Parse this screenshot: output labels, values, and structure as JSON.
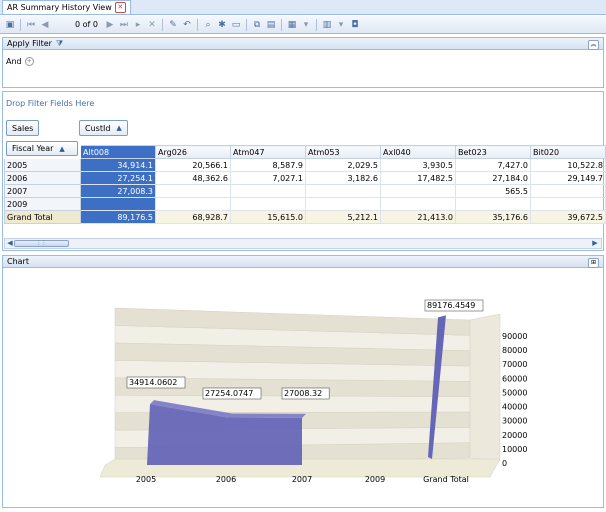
{
  "tab": {
    "title": "AR Summary History View"
  },
  "toolbar": {
    "page_info": "0 of 0"
  },
  "filter": {
    "title": "Apply Filter",
    "operator": "And"
  },
  "pivot": {
    "drop_filter_label": "Drop Filter Fields Here",
    "data_field": "Sales",
    "column_field": "CustId",
    "row_field": "Fiscal Year",
    "columns": [
      "Alt008",
      "Arg026",
      "Atm047",
      "Atm053",
      "Axl040",
      "Bet023",
      "Bit020"
    ],
    "rows": [
      {
        "label": "2005",
        "values": [
          "34,914.1",
          "20,566.1",
          "8,587.9",
          "2,029.5",
          "3,930.5",
          "7,427.0",
          "10,522.8"
        ]
      },
      {
        "label": "2006",
        "values": [
          "27,254.1",
          "48,362.6",
          "7,027.1",
          "3,182.6",
          "17,482.5",
          "27,184.0",
          "29,149.7"
        ]
      },
      {
        "label": "2007",
        "values": [
          "27,008.3",
          "",
          "",
          "",
          "",
          "565.5",
          ""
        ]
      },
      {
        "label": "2009",
        "values": [
          "",
          "",
          "",
          "",
          "",
          "",
          ""
        ]
      },
      {
        "label": "Grand Total",
        "values": [
          "89,176.5",
          "68,928.7",
          "15,615.0",
          "5,212.1",
          "21,413.0",
          "35,176.6",
          "39,672.5"
        ]
      }
    ]
  },
  "chart": {
    "title": "Chart"
  },
  "chart_data": {
    "type": "area",
    "categories": [
      "2005",
      "2006",
      "2007",
      "2009",
      "Grand Total"
    ],
    "series": [
      {
        "values": [
          34914.0602,
          27254.0747,
          27008.32,
          null,
          89176.4549
        ]
      }
    ],
    "data_labels": [
      "34914.0602",
      "27254.0747",
      "27008.32",
      "",
      "89176.4549"
    ],
    "yticks": [
      "0",
      "10000",
      "20000",
      "30000",
      "40000",
      "50000",
      "60000",
      "70000",
      "80000",
      "90000"
    ],
    "ylim": [
      0,
      90000
    ],
    "colors": {
      "series": "#6666b8",
      "wall": "#e8e4d8",
      "floor": "#eeead8"
    }
  }
}
